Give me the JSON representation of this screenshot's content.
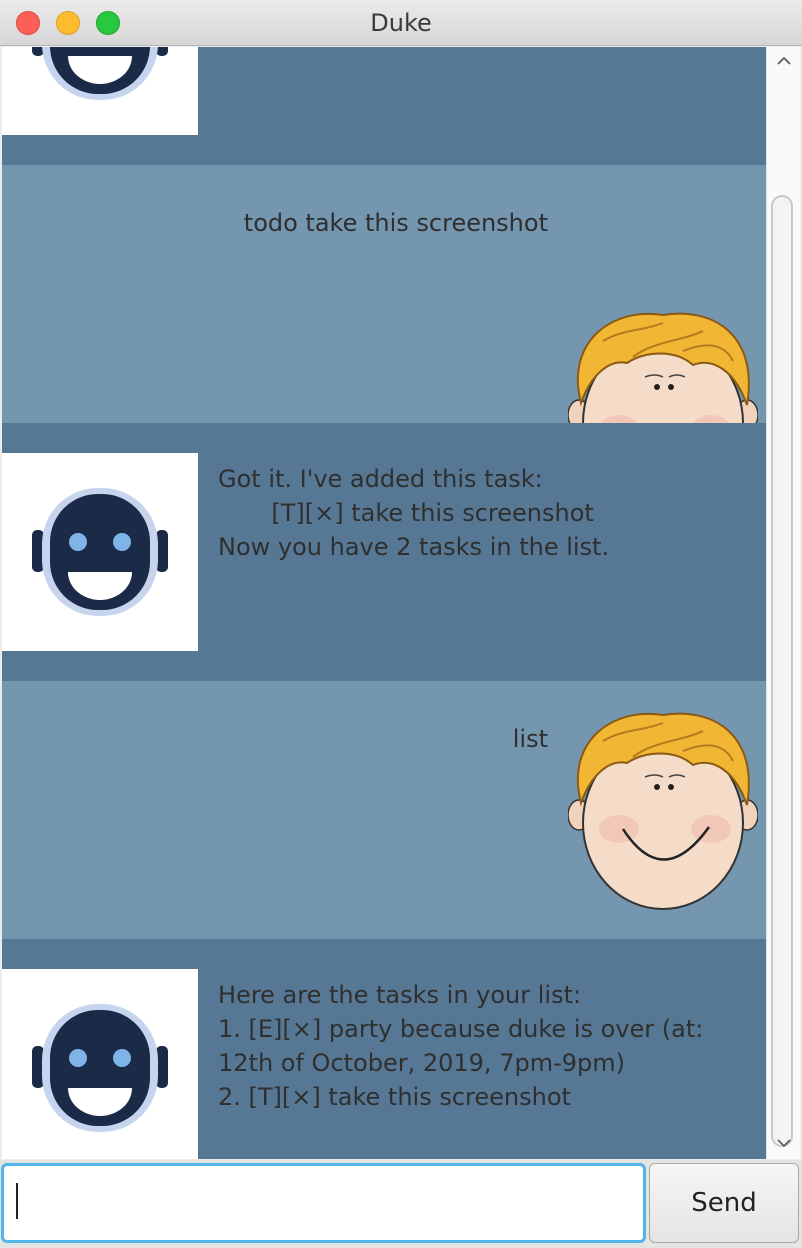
{
  "window": {
    "title": "Duke"
  },
  "messages": [
    {
      "sender": "user",
      "text": "todo take this screenshot"
    },
    {
      "sender": "duke",
      "text": "Got it. I've added this task:\n       [T][×] take this screenshot\nNow you have 2 tasks in the list."
    },
    {
      "sender": "user",
      "text": "list"
    },
    {
      "sender": "duke",
      "text": "Here are the tasks in your list:\n1. [E][×] party because duke is over (at:\n12th of October, 2019, 7pm-9pm)\n2. [T][×] take this screenshot"
    }
  ],
  "input": {
    "value": "",
    "send_label": "Send"
  },
  "icons": {
    "user_avatar": "cartoon-boy-face-icon",
    "duke_avatar": "robot-face-icon",
    "scroll_up": "chevron-up-icon",
    "scroll_down": "chevron-down-icon"
  },
  "colors": {
    "duke_bg": "#577894",
    "user_bg": "#7496af",
    "robot_dark": "#1b2a47",
    "robot_eye": "#7fb4e8",
    "focus": "#50b6e8"
  }
}
